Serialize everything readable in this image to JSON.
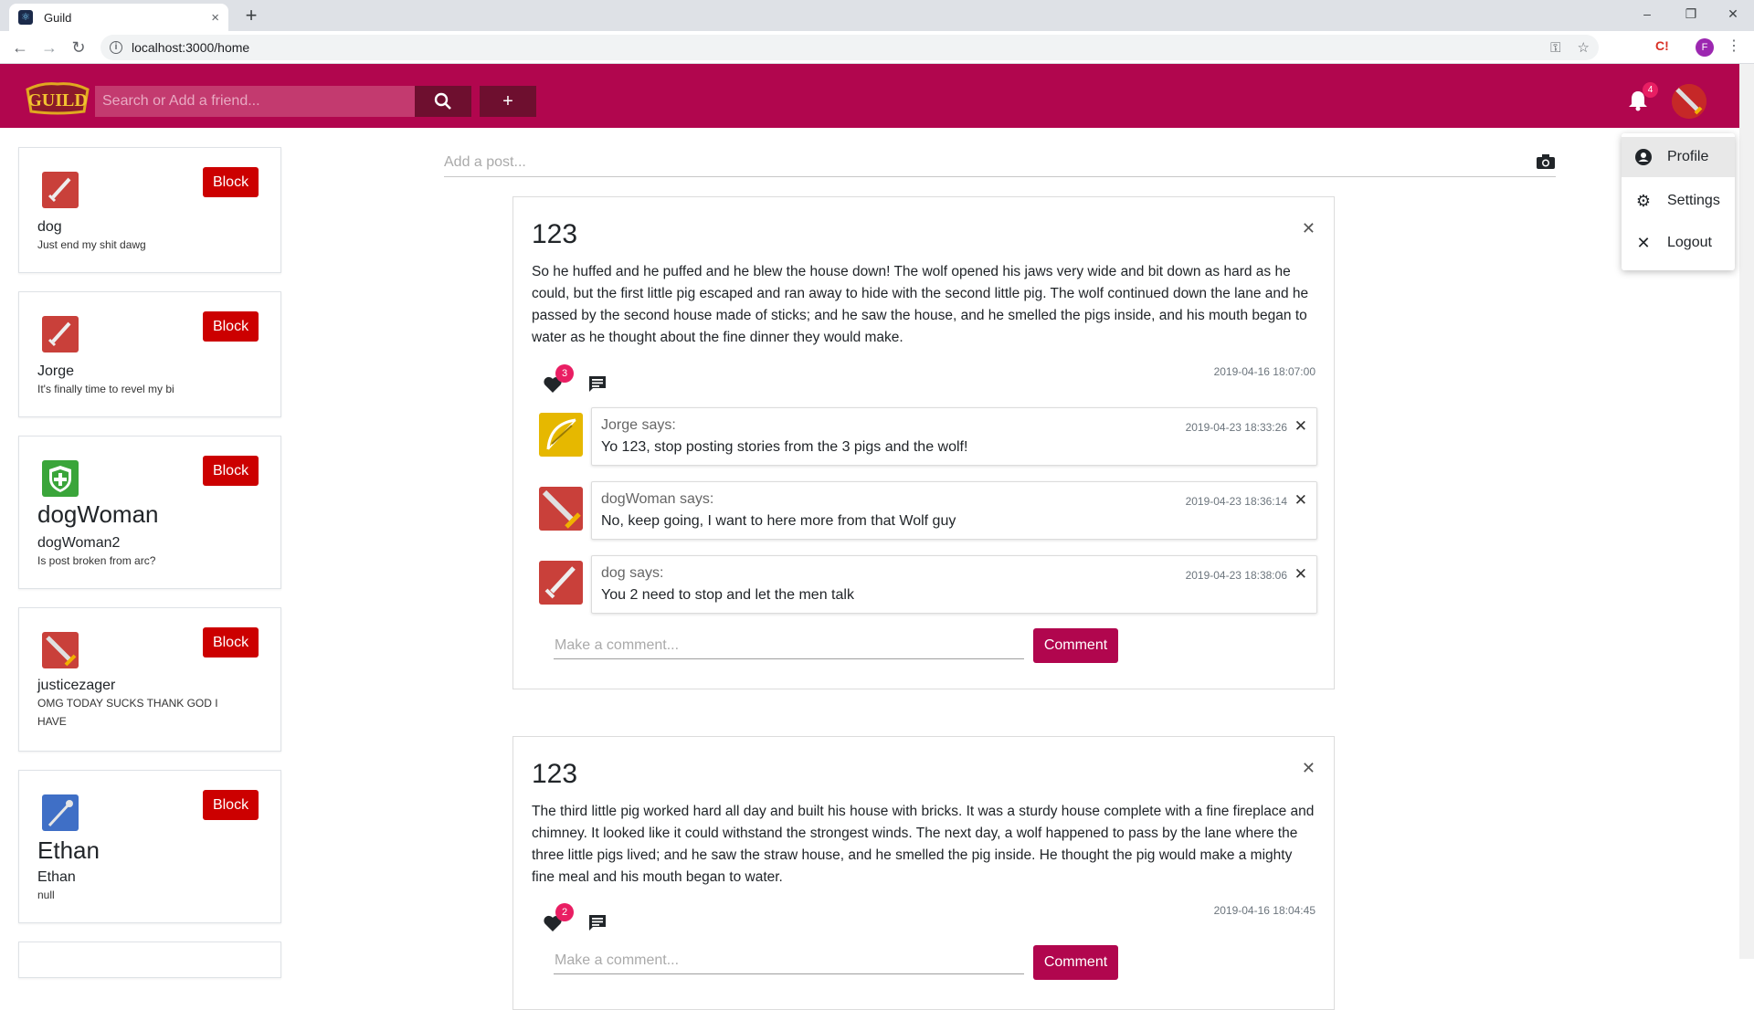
{
  "browser": {
    "tab_title": "Guild",
    "tab_close": "×",
    "new_tab": "+",
    "url": "localhost:3000/home",
    "profile_initial": "F",
    "window_minimize": "–",
    "window_restore": "❐",
    "window_close": "✕"
  },
  "header": {
    "search_placeholder": "Search or Add a friend...",
    "notification_count": "4",
    "brand_color": "#b1064e"
  },
  "user_menu": {
    "items": [
      {
        "label": "Profile",
        "icon": "account-circle-icon"
      },
      {
        "label": "Settings",
        "icon": "gear-icon"
      },
      {
        "label": "Logout",
        "icon": "close-icon"
      }
    ]
  },
  "friends": [
    {
      "display_name": "",
      "username": "dog",
      "status": "Just end my shit dawg",
      "avatar": "sword-icon",
      "block_label": "Block"
    },
    {
      "display_name": "",
      "username": "Jorge",
      "status": "It's finally time to revel my bi",
      "avatar": "sword-icon",
      "block_label": "Block"
    },
    {
      "display_name": "dogWoman",
      "username": "dogWoman2",
      "status": "Is post broken from arc?",
      "avatar": "shield-plus-icon",
      "block_label": "Block"
    },
    {
      "display_name": "",
      "username": "justicezager",
      "status": "OMG TODAY SUCKS THANK GOD I HAVE",
      "avatar": "sword-icon",
      "block_label": "Block"
    },
    {
      "display_name": "Ethan",
      "username": "Ethan",
      "status": "null",
      "avatar": "staff-icon",
      "block_label": "Block"
    }
  ],
  "add_post": {
    "placeholder": "Add a post..."
  },
  "posts": [
    {
      "title": "123",
      "body": "So he huffed and he puffed and he blew the house down! The wolf opened his jaws very wide and bit down as hard as he could, but the first little pig escaped and ran away to hide with the second little pig. The wolf continued down the lane and he passed by the second house made of sticks; and he saw the house, and he smelled the pigs inside, and his mouth began to water as he thought about the fine dinner they would make.",
      "likes": "3",
      "date": "2019-04-16 18:07:00",
      "comments": [
        {
          "author": "Jorge says:",
          "text": "Yo 123, stop posting stories from the 3 pigs and the wolf!",
          "date": "2019-04-23 18:33:26"
        },
        {
          "author": "dogWoman says:",
          "text": "No, keep going, I want to here more from that Wolf guy",
          "date": "2019-04-23 18:36:14"
        },
        {
          "author": "dog says:",
          "text": "You 2 need to stop and let the men talk",
          "date": "2019-04-23 18:38:06"
        }
      ],
      "comment_placeholder": "Make a comment...",
      "comment_button": "Comment"
    },
    {
      "title": "123",
      "body": "The third little pig worked hard all day and built his house with bricks. It was a sturdy house complete with a fine fireplace and chimney. It looked like it could withstand the strongest winds. The next day, a wolf happened to pass by the lane where the three little pigs lived; and he saw the straw house, and he smelled the pig inside. He thought the pig would make a mighty fine meal and his mouth began to water.",
      "likes": "2",
      "date": "2019-04-16 18:04:45",
      "comment_placeholder": "Make a comment...",
      "comment_button": "Comment"
    }
  ]
}
